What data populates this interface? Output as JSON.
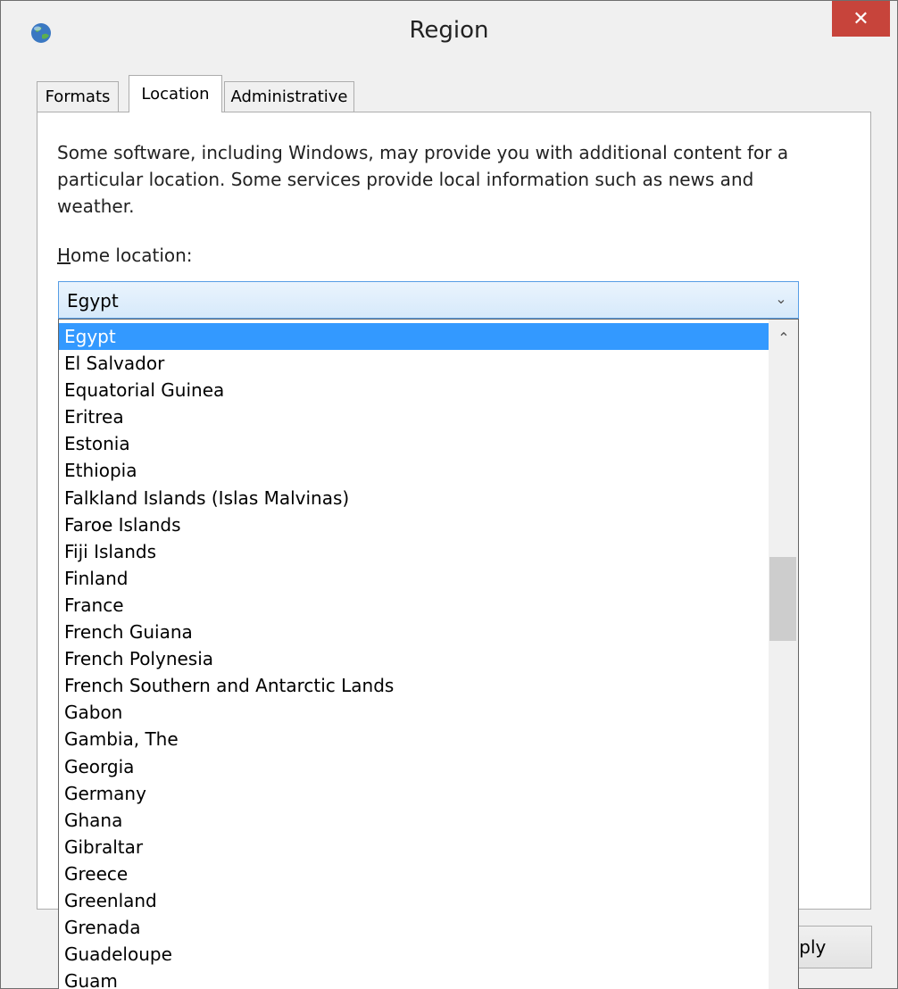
{
  "window": {
    "title": "Region"
  },
  "tabs": [
    {
      "label": "Formats"
    },
    {
      "label": "Location"
    },
    {
      "label": "Administrative"
    }
  ],
  "panel": {
    "description": "Some software, including Windows, may provide you with additional content for a particular location. Some services provide local information such as news and weather.",
    "home_label_first": "H",
    "home_label_rest": "ome location:"
  },
  "combo": {
    "value": "Egypt"
  },
  "dropdown": {
    "items": [
      "Egypt",
      "El Salvador",
      "Equatorial Guinea",
      "Eritrea",
      "Estonia",
      "Ethiopia",
      "Falkland Islands (Islas Malvinas)",
      "Faroe Islands",
      "Fiji Islands",
      "Finland",
      "France",
      "French Guiana",
      "French Polynesia",
      "French Southern and Antarctic Lands",
      "Gabon",
      "Gambia, The",
      "Georgia",
      "Germany",
      "Ghana",
      "Gibraltar",
      "Greece",
      "Greenland",
      "Grenada",
      "Guadeloupe",
      "Guam"
    ]
  },
  "buttons": {
    "apply_partial": "pply"
  },
  "icons": {
    "app": "globe-icon",
    "close": "close-icon",
    "combo_arrow": "chevron-down-icon",
    "scroll_up": "chevron-up-icon"
  },
  "colors": {
    "selection": "#3399ff",
    "close_button": "#c7443b",
    "combo_border": "#569de5"
  }
}
